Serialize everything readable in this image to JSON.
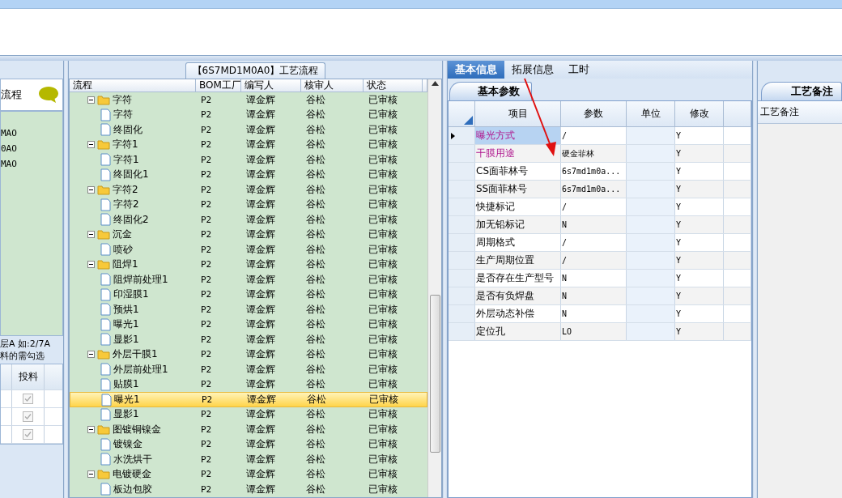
{
  "flow_panel": {
    "title": "【6S7MD1M0A0】工艺流程",
    "columns": [
      "流程",
      "BOM工厂",
      "编写人",
      "核审人",
      "状态"
    ],
    "tree": [
      {
        "kind": "folder",
        "name": "字符",
        "bom": "P2",
        "writer": "谭金辉",
        "reviewer": "谷松",
        "status": "已审核",
        "expanded": true,
        "selected": false,
        "children": [
          {
            "kind": "step",
            "name": "字符",
            "bom": "P2",
            "writer": "谭金辉",
            "reviewer": "谷松",
            "status": "已审核",
            "selected": false
          },
          {
            "kind": "step",
            "name": "终固化",
            "bom": "P2",
            "writer": "谭金辉",
            "reviewer": "谷松",
            "status": "已审核",
            "selected": false
          }
        ]
      },
      {
        "kind": "folder",
        "name": "字符1",
        "bom": "P2",
        "writer": "谭金辉",
        "reviewer": "谷松",
        "status": "已审核",
        "expanded": true,
        "selected": false,
        "children": [
          {
            "kind": "step",
            "name": "字符1",
            "bom": "P2",
            "writer": "谭金辉",
            "reviewer": "谷松",
            "status": "已审核",
            "selected": false
          },
          {
            "kind": "step",
            "name": "终固化1",
            "bom": "P2",
            "writer": "谭金辉",
            "reviewer": "谷松",
            "status": "已审核",
            "selected": false
          }
        ]
      },
      {
        "kind": "folder",
        "name": "字符2",
        "bom": "P2",
        "writer": "谭金辉",
        "reviewer": "谷松",
        "status": "已审核",
        "expanded": true,
        "selected": false,
        "children": [
          {
            "kind": "step",
            "name": "字符2",
            "bom": "P2",
            "writer": "谭金辉",
            "reviewer": "谷松",
            "status": "已审核",
            "selected": false
          },
          {
            "kind": "step",
            "name": "终固化2",
            "bom": "P2",
            "writer": "谭金辉",
            "reviewer": "谷松",
            "status": "已审核",
            "selected": false
          }
        ]
      },
      {
        "kind": "folder",
        "name": "沉金",
        "bom": "P2",
        "writer": "谭金辉",
        "reviewer": "谷松",
        "status": "已审核",
        "expanded": true,
        "selected": false,
        "children": [
          {
            "kind": "step",
            "name": "喷砂",
            "bom": "P2",
            "writer": "谭金辉",
            "reviewer": "谷松",
            "status": "已审核",
            "selected": false
          }
        ]
      },
      {
        "kind": "folder",
        "name": "阻焊1",
        "bom": "P2",
        "writer": "谭金辉",
        "reviewer": "谷松",
        "status": "已审核",
        "expanded": true,
        "selected": false,
        "children": [
          {
            "kind": "step",
            "name": "阻焊前处理1",
            "bom": "P2",
            "writer": "谭金辉",
            "reviewer": "谷松",
            "status": "已审核",
            "selected": false
          },
          {
            "kind": "step",
            "name": "印湿膜1",
            "bom": "P2",
            "writer": "谭金辉",
            "reviewer": "谷松",
            "status": "已审核",
            "selected": false
          },
          {
            "kind": "step",
            "name": "预烘1",
            "bom": "P2",
            "writer": "谭金辉",
            "reviewer": "谷松",
            "status": "已审核",
            "selected": false
          },
          {
            "kind": "step",
            "name": "曝光1",
            "bom": "P2",
            "writer": "谭金辉",
            "reviewer": "谷松",
            "status": "已审核",
            "selected": false
          },
          {
            "kind": "step",
            "name": "显影1",
            "bom": "P2",
            "writer": "谭金辉",
            "reviewer": "谷松",
            "status": "已审核",
            "selected": false
          }
        ]
      },
      {
        "kind": "folder",
        "name": "外层干膜1",
        "bom": "P2",
        "writer": "谭金辉",
        "reviewer": "谷松",
        "status": "已审核",
        "expanded": true,
        "selected": false,
        "children": [
          {
            "kind": "step",
            "name": "外层前处理1",
            "bom": "P2",
            "writer": "谭金辉",
            "reviewer": "谷松",
            "status": "已审核",
            "selected": false
          },
          {
            "kind": "step",
            "name": "贴膜1",
            "bom": "P2",
            "writer": "谭金辉",
            "reviewer": "谷松",
            "status": "已审核",
            "selected": false
          },
          {
            "kind": "step",
            "name": "曝光1",
            "bom": "P2",
            "writer": "谭金辉",
            "reviewer": "谷松",
            "status": "已审核",
            "selected": true
          },
          {
            "kind": "step",
            "name": "显影1",
            "bom": "P2",
            "writer": "谭金辉",
            "reviewer": "谷松",
            "status": "已审核",
            "selected": false
          }
        ]
      },
      {
        "kind": "folder",
        "name": "图镀铜镍金",
        "bom": "P2",
        "writer": "谭金辉",
        "reviewer": "谷松",
        "status": "已审核",
        "expanded": true,
        "selected": false,
        "children": [
          {
            "kind": "step",
            "name": "镀镍金",
            "bom": "P2",
            "writer": "谭金辉",
            "reviewer": "谷松",
            "status": "已审核",
            "selected": false
          },
          {
            "kind": "step",
            "name": "水洗烘干",
            "bom": "P2",
            "writer": "谭金辉",
            "reviewer": "谷松",
            "status": "已审核",
            "selected": false
          }
        ]
      },
      {
        "kind": "folder",
        "name": "电镀硬金",
        "bom": "P2",
        "writer": "谭金辉",
        "reviewer": "谷松",
        "status": "已审核",
        "expanded": true,
        "selected": false,
        "children": [
          {
            "kind": "step",
            "name": "板边包胶",
            "bom": "P2",
            "writer": "谭金辉",
            "reviewer": "谷松",
            "status": "已审核",
            "selected": false
          }
        ]
      }
    ]
  },
  "left_panel": {
    "title": "流程",
    "list": [
      "MAO",
      "0AO",
      "MAO"
    ],
    "note_lines": [
      "层A 如:2/7A",
      "料的需勾选"
    ],
    "columns": [
      "",
      "投料"
    ],
    "rows": [
      {
        "checked": true,
        "disabled": true
      },
      {
        "checked": true,
        "disabled": true
      },
      {
        "checked": true,
        "disabled": true
      }
    ]
  },
  "info_panel": {
    "tabs": [
      {
        "label": "基本信息",
        "selected": true
      },
      {
        "label": "拓展信息",
        "selected": false
      },
      {
        "label": "工时",
        "selected": false
      }
    ],
    "subtab": "基本参数",
    "columns": [
      "项目",
      "参数",
      "单位",
      "修改"
    ],
    "rows": [
      {
        "item": "曝光方式",
        "param": "/",
        "unit": "",
        "modify": "Y",
        "highlighted": true,
        "selected": true
      },
      {
        "item": "干膜用途",
        "param": "硬金菲林",
        "unit": "",
        "modify": "Y",
        "highlighted": true,
        "selected": false
      },
      {
        "item": "CS面菲林号",
        "param": "6s7md1m0a...",
        "unit": "",
        "modify": "Y",
        "highlighted": false,
        "selected": false
      },
      {
        "item": "SS面菲林号",
        "param": "6s7md1m0a...",
        "unit": "",
        "modify": "Y",
        "highlighted": false,
        "selected": false
      },
      {
        "item": "快捷标记",
        "param": "/",
        "unit": "",
        "modify": "Y",
        "highlighted": false,
        "selected": false
      },
      {
        "item": "加无铅标记",
        "param": "N",
        "unit": "",
        "modify": "Y",
        "highlighted": false,
        "selected": false
      },
      {
        "item": "周期格式",
        "param": "/",
        "unit": "",
        "modify": "Y",
        "highlighted": false,
        "selected": false
      },
      {
        "item": "生产周期位置",
        "param": "/",
        "unit": "",
        "modify": "Y",
        "highlighted": false,
        "selected": false
      },
      {
        "item": "是否存在生产型号",
        "param": "N",
        "unit": "",
        "modify": "Y",
        "highlighted": false,
        "selected": false
      },
      {
        "item": "是否有负焊盘",
        "param": "N",
        "unit": "",
        "modify": "Y",
        "highlighted": false,
        "selected": false
      },
      {
        "item": "外层动态补偿",
        "param": "N",
        "unit": "",
        "modify": "Y",
        "highlighted": false,
        "selected": false
      },
      {
        "item": "定位孔",
        "param": "LO",
        "unit": "",
        "modify": "Y",
        "highlighted": false,
        "selected": false
      }
    ]
  },
  "notes_panel": {
    "tab": "工艺备注",
    "header": "工艺备注"
  }
}
